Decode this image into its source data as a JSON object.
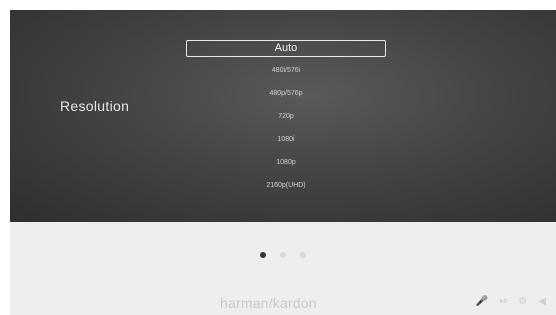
{
  "settings": {
    "label": "Resolution",
    "options": [
      {
        "label": "Auto",
        "selected": true
      },
      {
        "label": "480i/576i",
        "selected": false
      },
      {
        "label": "480p/576p",
        "selected": false
      },
      {
        "label": "720p",
        "selected": false
      },
      {
        "label": "1080i",
        "selected": false
      },
      {
        "label": "1080p",
        "selected": false
      },
      {
        "label": "2160p(UHD)",
        "selected": false
      }
    ]
  },
  "pager": {
    "total": 3,
    "active_index": 0
  },
  "footer": {
    "brand": "harman/kardon",
    "buttons": [
      {
        "icon": "mic-icon",
        "glyph": "🎤"
      },
      {
        "icon": "play-pause-icon",
        "glyph": "⏯"
      },
      {
        "icon": "settings-icon",
        "glyph": "⚙"
      },
      {
        "icon": "volume-icon",
        "glyph": "◀"
      }
    ]
  }
}
